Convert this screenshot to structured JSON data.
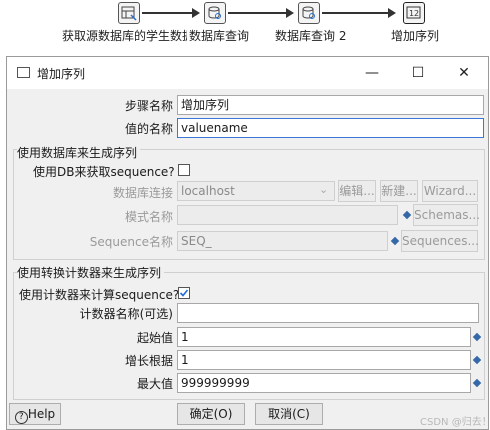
{
  "flow": {
    "steps": [
      {
        "label": "获取源数据库的学生数据",
        "icon": "table-input-icon"
      },
      {
        "label": "数据库查询",
        "icon": "db-lookup-icon"
      },
      {
        "label": "数据库查询 2",
        "icon": "db-lookup-icon"
      },
      {
        "label": "增加序列",
        "icon": "add-sequence-icon"
      }
    ]
  },
  "dialog": {
    "title": "增加序列",
    "window_controls": {
      "minimize": "—",
      "maximize": "☐",
      "close": "✕"
    },
    "step_name_label": "步骤名称",
    "step_name_value": "增加序列",
    "value_name_label": "值的名称",
    "value_name_value": "valuename",
    "db_group": {
      "title": "使用数据库来生成序列",
      "use_db_label": "使用DB来获取sequence?",
      "use_db_checked": false,
      "connection_label": "数据库连接",
      "connection_value": "localhost",
      "edit_button": "编辑...",
      "new_button": "新建...",
      "wizard_button": "Wizard...",
      "schema_label": "模式名称",
      "schema_value": "",
      "schemas_button": "Schemas...",
      "sequence_label": "Sequence名称",
      "sequence_value": "SEQ_",
      "sequences_button": "Sequences..."
    },
    "counter_group": {
      "title": "使用转换计数器来生成序列",
      "use_counter_label": "使用计数器来计算sequence?",
      "use_counter_checked": true,
      "counter_name_label": "计数器名称(可选)",
      "counter_name_value": "",
      "start_label": "起始值",
      "start_value": "1",
      "increment_label": "增长根据",
      "increment_value": "1",
      "max_label": "最大值",
      "max_value": "999999999"
    },
    "help_button": "Help",
    "ok_button": "确定(O)",
    "cancel_button": "取消(C)",
    "watermark": "CSDN @归去！"
  },
  "colors": {
    "accent": "#3568a8",
    "focus": "#3a77d6",
    "check": "#1e6fd9"
  }
}
